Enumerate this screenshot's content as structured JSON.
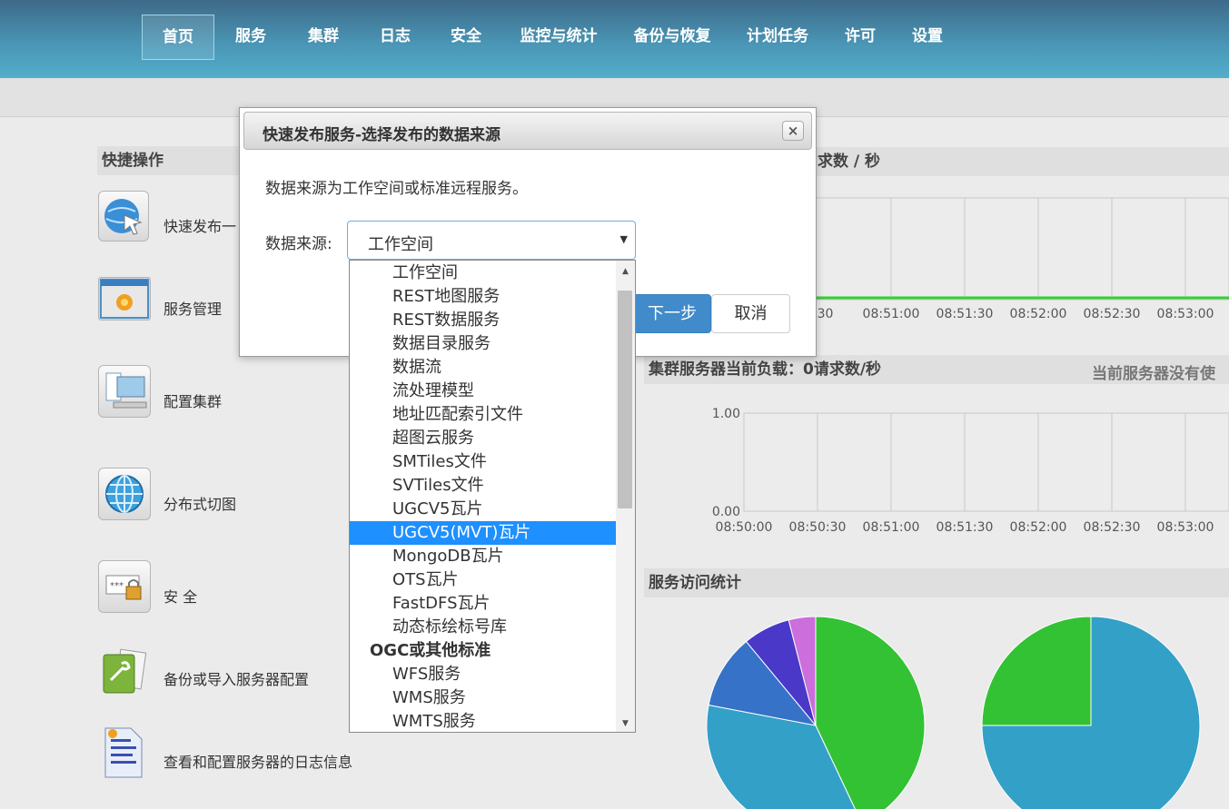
{
  "nav": {
    "items": [
      "首页",
      "服务",
      "集群",
      "日志",
      "安全",
      "监控与统计",
      "备份与恢复",
      "计划任务",
      "许可",
      "设置"
    ],
    "active_index": 0
  },
  "quick_ops": {
    "title": "快捷操作",
    "items": [
      {
        "label": "快速发布一",
        "icon": "globe-publish-icon"
      },
      {
        "label": "服务管理",
        "icon": "gear-window-icon"
      },
      {
        "label": "配置集群",
        "icon": "computers-icon"
      },
      {
        "label": "分布式切图",
        "icon": "globe-grid-icon"
      },
      {
        "label": "安 全",
        "icon": "lock-password-icon"
      },
      {
        "label": "备份或导入服务器配置",
        "icon": "backup-tool-icon"
      },
      {
        "label": "查看和配置服务器的日志信息",
        "icon": "log-document-icon"
      }
    ]
  },
  "charts": {
    "top_title_partial": "求数 / 秒",
    "middle_title": "集群服务器当前负载：0请求数/秒",
    "middle_right_note": "当前服务器没有使",
    "bottom_title": "服务访问统计"
  },
  "chart_data": [
    {
      "type": "line",
      "x": [
        "08:50:30",
        "08:51:00",
        "08:51:30",
        "08:52:00",
        "08:52:30",
        "08:53:00"
      ],
      "x_tick_labels_visible": [
        "0:30",
        "08:51:00",
        "08:51:30",
        "08:52:00",
        "08:52:30",
        "08:53:00"
      ],
      "series": [
        {
          "values": [
            0,
            0,
            0,
            0,
            0,
            0
          ],
          "color": "#35d035"
        }
      ]
    },
    {
      "type": "line",
      "x": [
        "08:50:00",
        "08:50:30",
        "08:51:00",
        "08:51:30",
        "08:52:00",
        "08:52:30",
        "08:53:00"
      ],
      "ylim": [
        0,
        1
      ],
      "y_ticks": [
        "0.00",
        "1.00"
      ],
      "series": []
    },
    {
      "type": "pie",
      "slices": [
        {
          "value": 43,
          "color": "#33c233"
        },
        {
          "value": 35,
          "color": "#33a0c8"
        },
        {
          "value": 11,
          "color": "#3672c8"
        },
        {
          "value": 7,
          "color": "#4a38c8"
        },
        {
          "value": 4,
          "color": "#cc6edc"
        }
      ]
    },
    {
      "type": "pie",
      "slices": [
        {
          "value": 75,
          "color": "#33a0c8"
        },
        {
          "value": 25,
          "color": "#33c233"
        }
      ]
    }
  ],
  "dialog": {
    "title": "快速发布服务-选择发布的数据来源",
    "close_glyph": "×",
    "description": "数据来源为工作空间或标准远程服务。",
    "source_label": "数据来源:",
    "selected_value": "工作空间",
    "caret": "▼",
    "next_button": "下一步",
    "cancel_button": "取消",
    "options": [
      {
        "label": "工作空间",
        "kind": "opt"
      },
      {
        "label": "REST地图服务",
        "kind": "opt"
      },
      {
        "label": "REST数据服务",
        "kind": "opt"
      },
      {
        "label": "数据目录服务",
        "kind": "opt"
      },
      {
        "label": "数据流",
        "kind": "opt"
      },
      {
        "label": "流处理模型",
        "kind": "opt"
      },
      {
        "label": "地址匹配索引文件",
        "kind": "opt"
      },
      {
        "label": "超图云服务",
        "kind": "opt"
      },
      {
        "label": "SMTiles文件",
        "kind": "opt"
      },
      {
        "label": "SVTiles文件",
        "kind": "opt"
      },
      {
        "label": "UGCV5瓦片",
        "kind": "opt"
      },
      {
        "label": "UGCV5(MVT)瓦片",
        "kind": "opt",
        "highlighted": true
      },
      {
        "label": "MongoDB瓦片",
        "kind": "opt"
      },
      {
        "label": "OTS瓦片",
        "kind": "opt"
      },
      {
        "label": "FastDFS瓦片",
        "kind": "opt"
      },
      {
        "label": "动态标绘标号库",
        "kind": "opt"
      },
      {
        "label": "OGC或其他标准",
        "kind": "group"
      },
      {
        "label": "WFS服务",
        "kind": "opt"
      },
      {
        "label": "WMS服务",
        "kind": "opt"
      },
      {
        "label": "WMTS服务",
        "kind": "opt"
      }
    ],
    "scroll_up_glyph": "▲",
    "scroll_down_glyph": "▼"
  }
}
